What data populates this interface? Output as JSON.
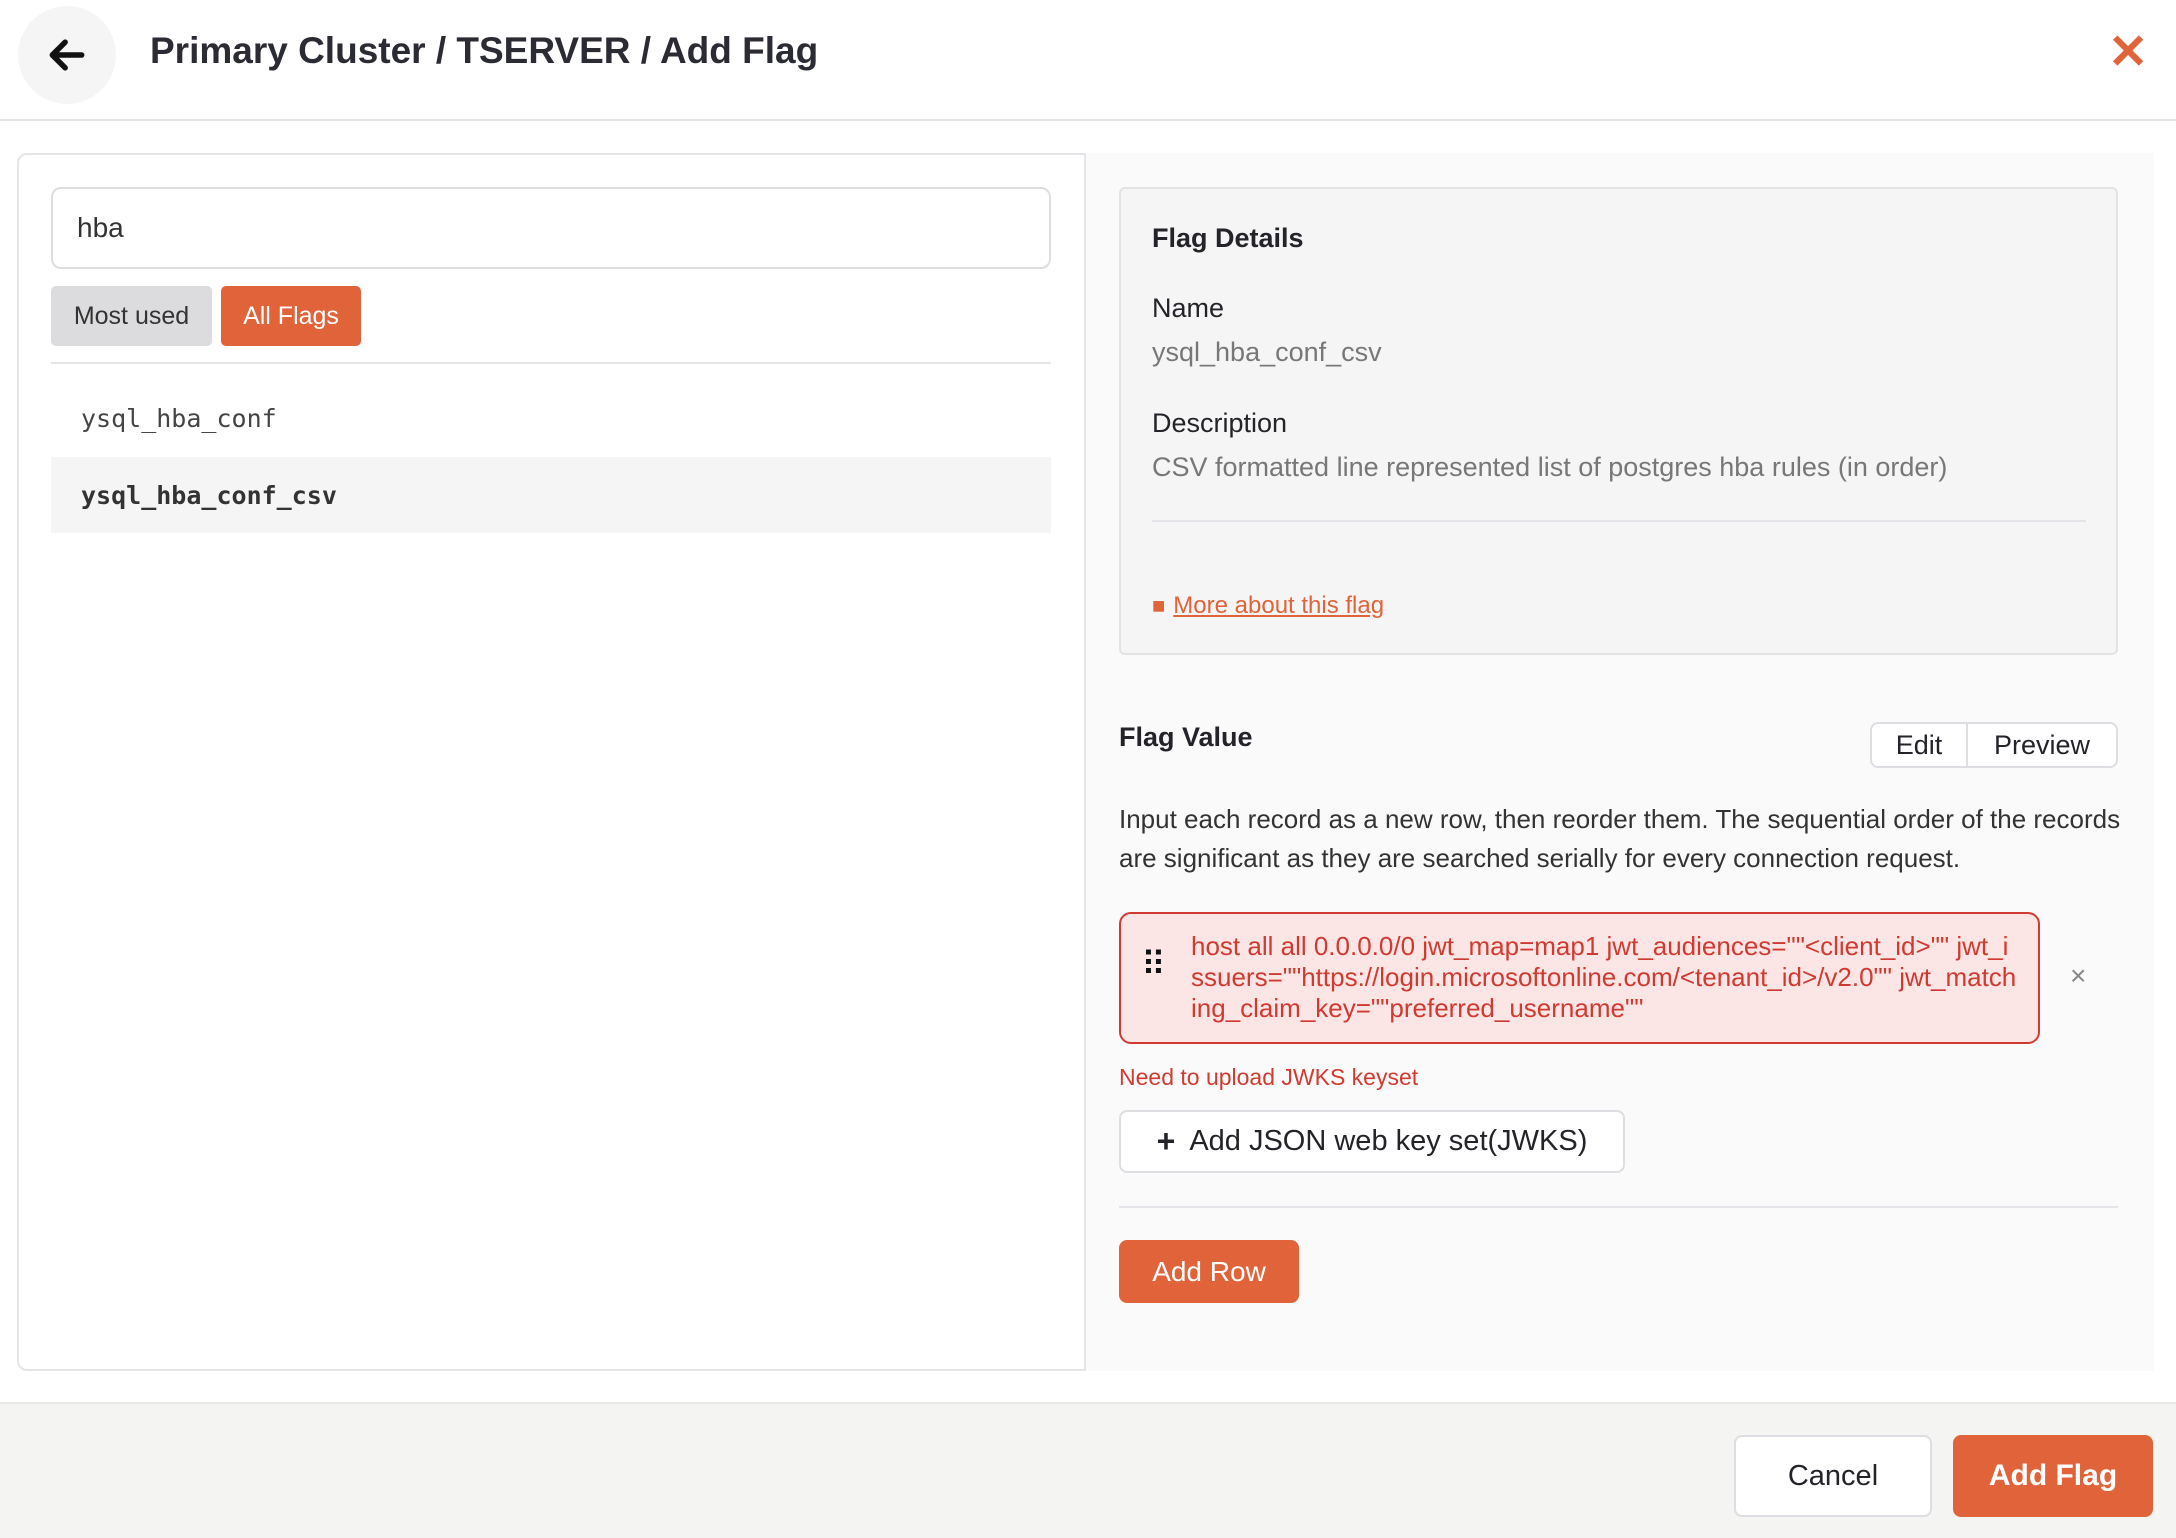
{
  "header": {
    "title": "Primary Cluster / TSERVER / Add Flag",
    "back_icon": "arrow-left-icon",
    "close_icon": "close-icon"
  },
  "search": {
    "value": "hba"
  },
  "tabs": [
    {
      "label": "Most used",
      "active": false
    },
    {
      "label": "All Flags",
      "active": true
    }
  ],
  "flags": [
    {
      "name": "ysql_hba_conf",
      "selected": false
    },
    {
      "name": "ysql_hba_conf_csv",
      "selected": true
    }
  ],
  "details": {
    "title": "Flag Details",
    "name_label": "Name",
    "name_value": "ysql_hba_conf_csv",
    "description_label": "Description",
    "description_value": "CSV formatted line represented list of postgres hba rules (in order)",
    "more_link": "More about this flag"
  },
  "flag_value": {
    "title": "Flag Value",
    "edit_label": "Edit",
    "preview_label": "Preview",
    "help_text": "Input each record as a new row, then reorder them. The sequential order of the records are significant as they are searched serially for every connection request.",
    "row_value": "host all all 0.0.0.0/0 jwt_map=map1 jwt_audiences=\"\"<client_id>\"\" jwt_issuers=\"\"https://login.microsoftonline.com/<tenant_id>/v2.0\"\" jwt_matching_claim_key=\"\"preferred_username\"\"",
    "error": "Need to upload JWKS keyset",
    "jwks_button": "Add JSON web key set(JWKS)",
    "add_row": "Add Row"
  },
  "footer": {
    "cancel": "Cancel",
    "submit": "Add Flag"
  },
  "colors": {
    "accent": "#e0633a",
    "error": "#d13a30"
  }
}
